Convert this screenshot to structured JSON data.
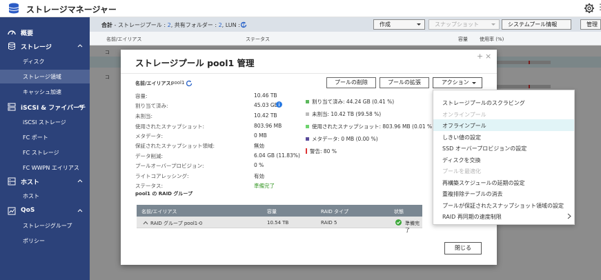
{
  "app": {
    "title": "ストレージマネージャー",
    "more": "⋮"
  },
  "sidebar": {
    "items": [
      {
        "id": "overview",
        "label": "概要",
        "type": "section",
        "icon": "dashboard-icon",
        "expandable": false
      },
      {
        "id": "storage",
        "label": "ストレージ",
        "type": "section",
        "icon": "database-icon",
        "expandable": true
      },
      {
        "id": "disk",
        "label": "ディスク",
        "type": "sub"
      },
      {
        "id": "storage-space",
        "label": "ストレージ領域",
        "type": "sub",
        "active": true
      },
      {
        "id": "cache",
        "label": "キャッシュ加速",
        "type": "sub"
      },
      {
        "id": "iscsi",
        "label": "iSCSI & ファイバーチ",
        "type": "section",
        "icon": "iscsi-icon",
        "expandable": true
      },
      {
        "id": "iscsi-storage",
        "label": "iSCSI ストレージ",
        "type": "sub"
      },
      {
        "id": "fc-port",
        "label": "FC ポート",
        "type": "sub"
      },
      {
        "id": "fc-storage",
        "label": "FC ストレージ",
        "type": "sub"
      },
      {
        "id": "fc-wwpn",
        "label": "FC WWPN エイリアス",
        "type": "sub"
      },
      {
        "id": "host",
        "label": "ホスト",
        "type": "section",
        "icon": "host-icon",
        "expandable": true
      },
      {
        "id": "host-sub",
        "label": "ホスト",
        "type": "sub"
      },
      {
        "id": "qos",
        "label": "QoS",
        "type": "section",
        "icon": "qos-icon",
        "expandable": true
      },
      {
        "id": "storage-group",
        "label": "ストレージグループ",
        "type": "sub"
      },
      {
        "id": "policy",
        "label": "ポリシー",
        "type": "sub"
      }
    ]
  },
  "summary": {
    "total_label": "合計",
    "pools_label": " - ストレージプール : ",
    "pools": "2",
    "folders_label": ", 共有フォルダー : ",
    "folders": "2",
    "lun_label": ", LUN : ",
    "lun": "1"
  },
  "toolbar": {
    "create": "作成",
    "snapshot": "スナップショット",
    "pool_info": "システムプール情報",
    "manage": "管理"
  },
  "bg_table": {
    "headers": [
      "名前/エイリアス",
      "ステータス",
      "容量",
      "使用率 (%)"
    ],
    "rows": [
      "コ",
      "コ"
    ]
  },
  "dialog": {
    "title": "ストレージプール pool1 管理",
    "alias_label": "名前/エイリアス:",
    "alias_value": "pool1",
    "buttons": {
      "delete": "プールの削除",
      "expand": "プールの拡張",
      "action": "アクション"
    },
    "properties": [
      {
        "label": "容量:",
        "value": "10.46 TB"
      },
      {
        "label": "割り当て済み:",
        "value": "45.03 GB"
      },
      {
        "label": "未割当:",
        "value": "10.42 TB"
      },
      {
        "label": "使用されたスナップショット:",
        "value": "803.96 MB"
      },
      {
        "label": "メタデータ:",
        "value": "0 MB"
      },
      {
        "label": "保証されたスナップショット領域:",
        "value": "無効"
      },
      {
        "label": "データ削減:",
        "value": "6.04 GB (11.83%)"
      },
      {
        "label": "プールオーバープロビジョン:",
        "value": "0 %"
      },
      {
        "label": "ライトコアレッシング:",
        "value": "有効"
      },
      {
        "label": "ステータス:",
        "value": "準備完了",
        "ok": true
      }
    ],
    "raid_group_title": "pool1 の RAID グループ",
    "legend": [
      {
        "label": "割り当て済み: 44.24 GB (0.41 %)",
        "color": "#5cb85c"
      },
      {
        "label": "未割当: 10.42 TB (99.58 %)",
        "color": "#bbbbbb"
      },
      {
        "label": "使用されたスナップショット: 803.96 MB (0.01 %)",
        "color": "#6ed36e"
      },
      {
        "label": "メタデータ: 0 MB (0.00 %)",
        "color": "#5a4b9a"
      },
      {
        "label": "警告: 80 %",
        "color": "#d33333"
      }
    ],
    "raid_table": {
      "headers": [
        "名前/エイリアス",
        "容量",
        "RAID タイプ",
        "状態"
      ],
      "row": {
        "name": "RAID グループ pool1-0",
        "capacity": "10.54 TB",
        "raid": "RAID 5",
        "status": "準備完了"
      }
    },
    "close": "閉じる"
  },
  "action_menu": {
    "items": [
      {
        "label": "ストレージプールのスクラビング",
        "disabled": false
      },
      {
        "label": "オンラインプール",
        "disabled": true
      },
      {
        "label": "オフラインプール",
        "disabled": false,
        "highlighted": true
      },
      {
        "label": "しきい値の設定",
        "disabled": false
      },
      {
        "label": "SSD オーバープロビジョンの設定",
        "disabled": false
      },
      {
        "label": "ディスクを交換",
        "disabled": false
      },
      {
        "label": "プールを最適化",
        "disabled": true
      },
      {
        "label": "再構築スケジュールの延期の設定",
        "disabled": false
      },
      {
        "label": "重複排除テーブルの消去",
        "disabled": false
      },
      {
        "label": "プールが保証されたスナップショット領域の設定",
        "disabled": false
      },
      {
        "label": "RAID 再同期の速度制限",
        "disabled": false,
        "submenu": true
      }
    ]
  },
  "colors": {
    "sidebar": "#2c427a",
    "sidebar_active": "#4f6394",
    "accent": "#2a63c9",
    "ok": "#3a9a2a",
    "warning": "#d33333"
  }
}
